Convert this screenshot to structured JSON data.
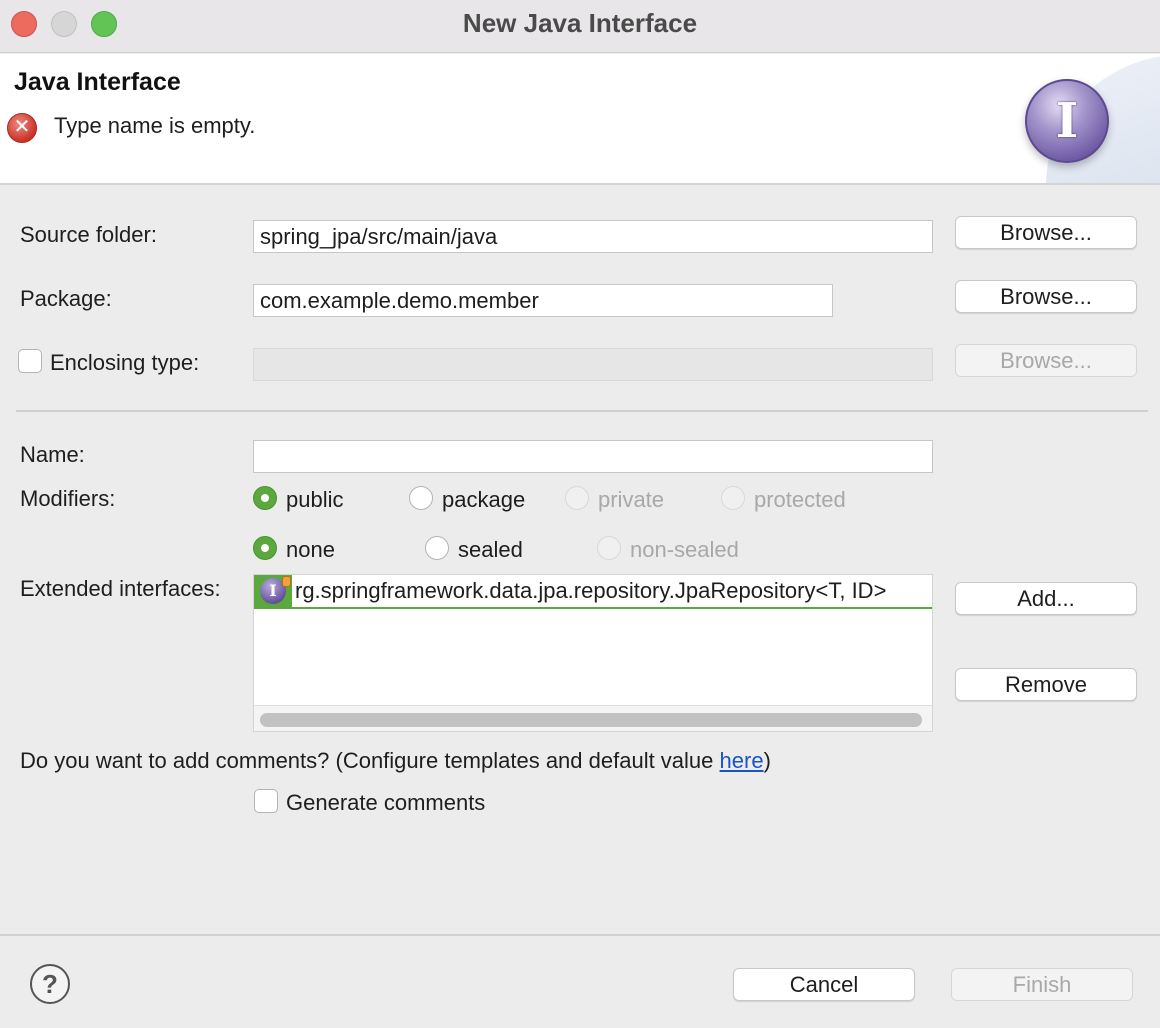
{
  "window": {
    "title": "New Java Interface"
  },
  "banner": {
    "title": "Java Interface",
    "message": "Type name is empty.",
    "error_icon": "error-icon",
    "wizard_icon": "I"
  },
  "form": {
    "source_folder": {
      "label": "Source folder:",
      "value": "spring_jpa/src/main/java",
      "browse_label": "Browse..."
    },
    "package": {
      "label": "Package:",
      "value": "com.example.demo.member",
      "browse_label": "Browse..."
    },
    "enclosing_type": {
      "label": "Enclosing type:",
      "value": "",
      "checked": false,
      "browse_label": "Browse..."
    },
    "name": {
      "label": "Name:",
      "value": ""
    },
    "modifiers": {
      "label": "Modifiers:",
      "access": [
        {
          "label": "public",
          "checked": true,
          "enabled": true
        },
        {
          "label": "package",
          "checked": false,
          "enabled": true
        },
        {
          "label": "private",
          "checked": false,
          "enabled": false
        },
        {
          "label": "protected",
          "checked": false,
          "enabled": false
        }
      ],
      "sealing": [
        {
          "label": "none",
          "checked": true,
          "enabled": true
        },
        {
          "label": "sealed",
          "checked": false,
          "enabled": true
        },
        {
          "label": "non-sealed",
          "checked": false,
          "enabled": false
        }
      ]
    },
    "extended_interfaces": {
      "label": "Extended interfaces:",
      "items": [
        "rg.springframework.data.jpa.repository.JpaRepository<T, ID>"
      ],
      "item_icon": "I",
      "add_label": "Add...",
      "remove_label": "Remove"
    },
    "comments": {
      "question_prefix": "Do you want to add comments? (Configure templates and default value ",
      "link_text": "here",
      "question_suffix": ")",
      "generate_label": "Generate comments",
      "generate_checked": false
    }
  },
  "footer": {
    "help_icon": "?",
    "cancel_label": "Cancel",
    "finish_label": "Finish"
  },
  "colors": {
    "accent_green": "#5aa83e",
    "error_red": "#c9332a",
    "link_blue": "#1a54c9",
    "interface_purple": "#6f5ca6"
  }
}
